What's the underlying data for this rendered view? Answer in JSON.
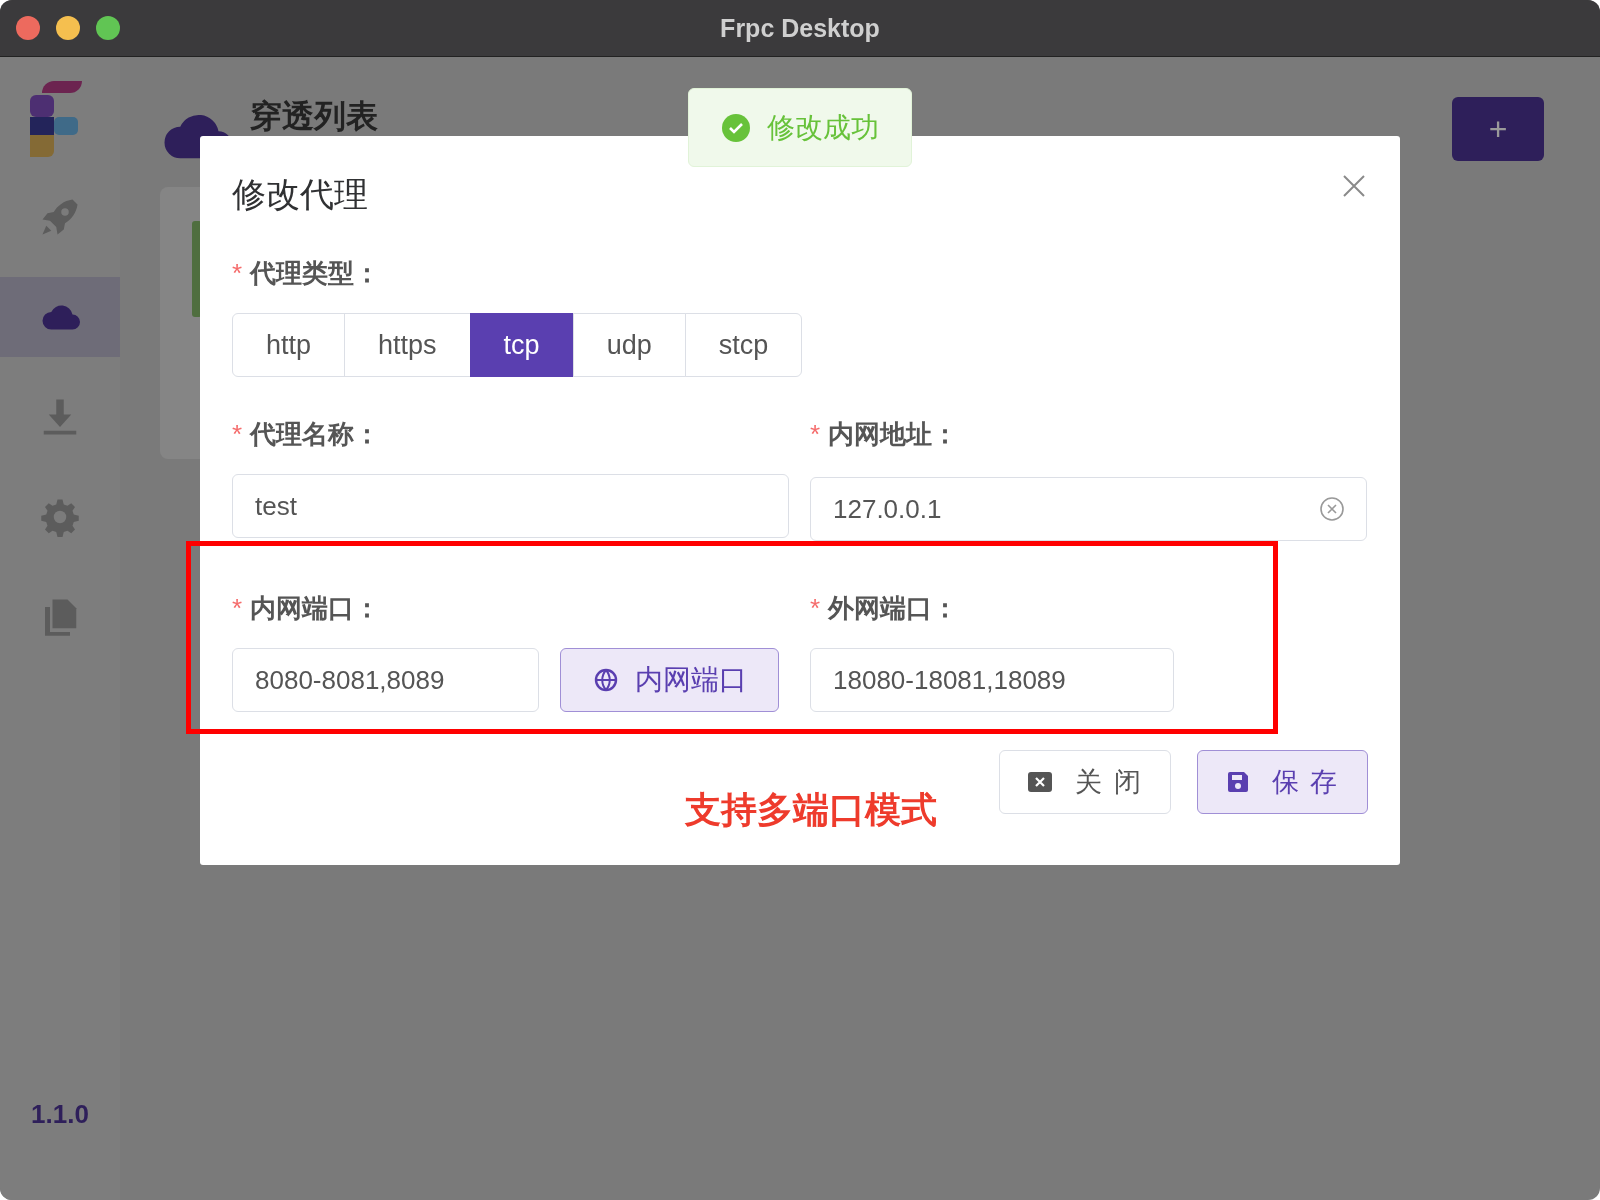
{
  "window": {
    "title": "Frpc Desktop"
  },
  "sidebar": {
    "items": [
      {
        "kind": "rocket",
        "selected": false
      },
      {
        "kind": "cloud",
        "selected": true
      },
      {
        "kind": "download",
        "selected": false
      },
      {
        "kind": "settings",
        "selected": false
      },
      {
        "kind": "file",
        "selected": false
      }
    ],
    "version": "1.1.0"
  },
  "page": {
    "title": "穿透列表",
    "add_button": "+"
  },
  "toast": {
    "kind": "success",
    "text": "修改成功"
  },
  "dialog": {
    "title": "修改代理",
    "proxy_type": {
      "required_mark": "*",
      "label": "代理类型：",
      "options": [
        {
          "label": "http",
          "selected": false
        },
        {
          "label": "https",
          "selected": false
        },
        {
          "label": "tcp",
          "selected": true
        },
        {
          "label": "udp",
          "selected": false
        },
        {
          "label": "stcp",
          "selected": false
        }
      ]
    },
    "proxy_name": {
      "required_mark": "*",
      "label": "代理名称：",
      "value": "test"
    },
    "local_ip": {
      "required_mark": "*",
      "label": "内网地址：",
      "value": "127.0.0.1",
      "clearable": true
    },
    "local_port": {
      "required_mark": "*",
      "label": "内网端口：",
      "value": "8080-8081,8089",
      "button": "内网端口"
    },
    "remote_port": {
      "required_mark": "*",
      "label": "外网端口：",
      "value": "18080-18081,18089"
    },
    "buttons": [
      {
        "kind": "close",
        "label": "关 闭"
      },
      {
        "kind": "save",
        "label": "保 存"
      }
    ]
  },
  "annotation": {
    "text": "支持多端口模式"
  }
}
